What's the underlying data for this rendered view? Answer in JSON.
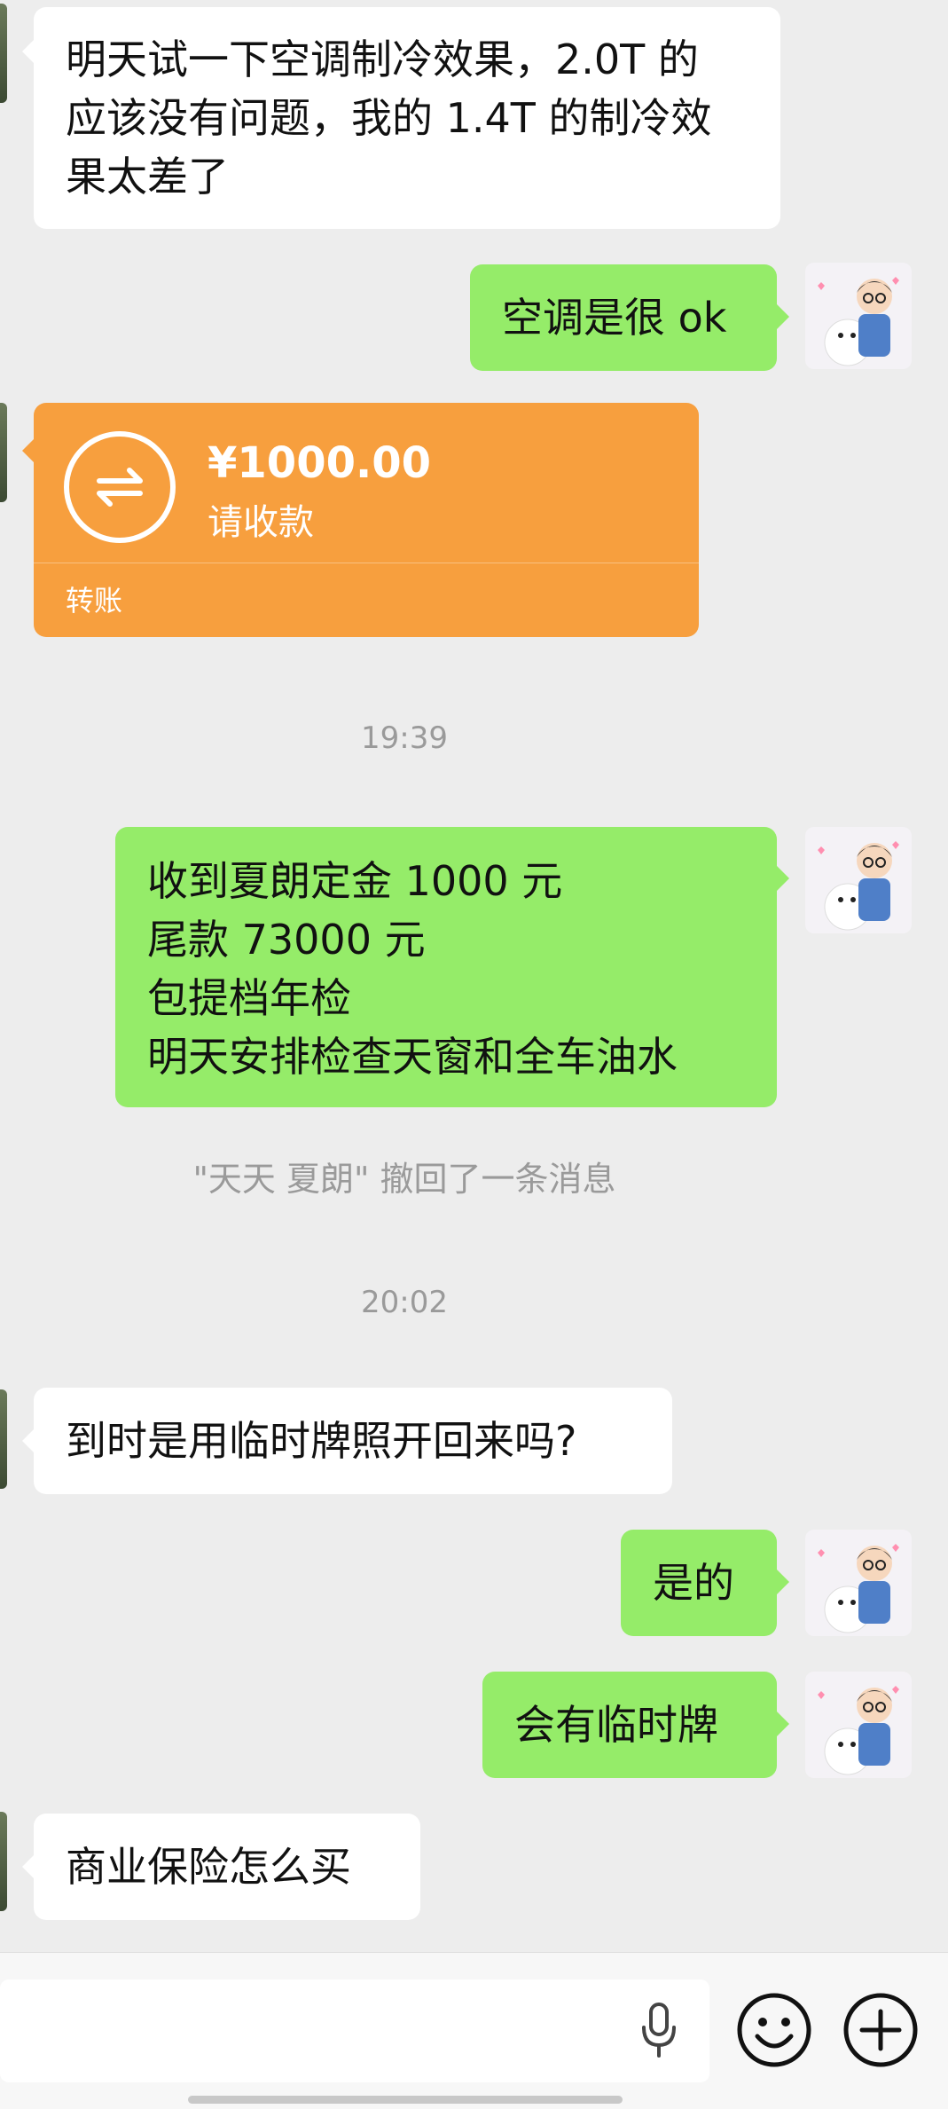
{
  "messages": [
    {
      "side": "left",
      "lines": [
        "明天试一下空调制冷效果，2.0T 的",
        "应该没有问题，我的 1.4T 的制冷效",
        "果太差了"
      ]
    },
    {
      "side": "right",
      "lines": [
        "空调是很 ok"
      ]
    },
    {
      "side": "left",
      "type": "transfer",
      "amount": "¥1000.00",
      "status": "请收款",
      "label": "转账"
    },
    {
      "side": "system",
      "text": "19:39"
    },
    {
      "side": "right",
      "lines": [
        "收到夏朗定金 1000 元",
        "尾款 73000 元",
        "包提档年检",
        "明天安排检查天窗和全车油水"
      ]
    },
    {
      "side": "system",
      "text": "\"天天 夏朗\" 撤回了一条消息"
    },
    {
      "side": "system",
      "text": "20:02"
    },
    {
      "side": "left",
      "lines": [
        "到时是用临时牌照开回来吗?"
      ]
    },
    {
      "side": "right",
      "lines": [
        "是的"
      ]
    },
    {
      "side": "right",
      "lines": [
        "会有临时牌"
      ]
    },
    {
      "side": "left",
      "lines": [
        "商业保险怎么买"
      ]
    }
  ],
  "input": {
    "placeholder": ""
  },
  "colors": {
    "bg": "#ededed",
    "self_bubble": "#95ec69",
    "other_bubble": "#ffffff",
    "transfer": "#f79f3e",
    "muted": "#9a9a9a"
  },
  "icons": {
    "voice": "mic-icon",
    "emoji": "smile-icon",
    "more": "plus-circle-icon"
  }
}
